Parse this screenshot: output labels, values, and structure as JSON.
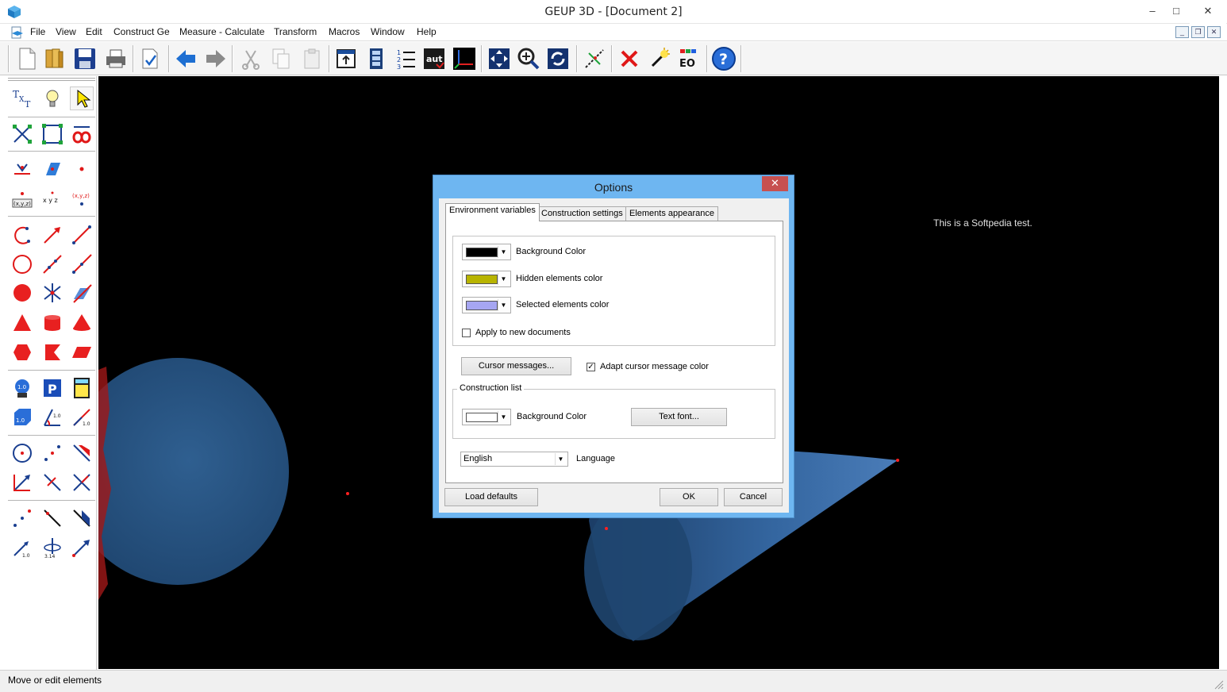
{
  "window": {
    "title": "GEUP 3D - [Document 2]",
    "controls": {
      "minimize": "–",
      "maximize": "□",
      "close": "✕"
    }
  },
  "menu": {
    "items": [
      "File",
      "View",
      "Edit",
      "Construct Ge",
      "Measure - Calculate",
      "Transform",
      "Macros",
      "Window",
      "Help"
    ],
    "mdi_controls": {
      "minimize": "_",
      "restore": "❐",
      "close": "✕"
    }
  },
  "toolbar": {
    "buttons": [
      "new-document",
      "open-folder",
      "save",
      "print",
      "print-preview",
      "undo-arrow",
      "redo-arrow",
      "cut",
      "copy",
      "paste",
      "window-view",
      "film-animation",
      "numbered-list",
      "auto-mode",
      "axes",
      "fit-view",
      "zoom",
      "rotate-view",
      "trace",
      "delete",
      "light",
      "eo-labels",
      "help"
    ]
  },
  "canvas": {
    "annotation": "This is a Softpedia test.",
    "background": "#000000"
  },
  "dialog": {
    "title": "Options",
    "close_label": "✕",
    "tabs": [
      "Environment variables",
      "Construction settings",
      "Elements appearance"
    ],
    "active_tab": "Environment variables",
    "colors": {
      "background": {
        "label": "Background Color",
        "value": "#000000"
      },
      "hidden": {
        "label": "Hidden elements color",
        "value": "#b8b400"
      },
      "selected": {
        "label": "Selected elements color",
        "value": "#a6a6f2"
      }
    },
    "apply_new_docs": {
      "label": "Apply to new documents",
      "checked": false
    },
    "cursor_messages_button": "Cursor messages...",
    "adapt_cursor": {
      "label": "Adapt cursor message color",
      "checked": true,
      "mark": "✓"
    },
    "construction_list": {
      "group_label": "Construction list",
      "bg_label": "Background Color",
      "bg_value": "#ffffff",
      "text_font_button": "Text font..."
    },
    "language": {
      "label": "Language",
      "value": "English"
    },
    "buttons": {
      "load_defaults": "Load defaults",
      "ok": "OK",
      "cancel": "Cancel"
    }
  },
  "status": {
    "text": "Move or edit elements"
  }
}
